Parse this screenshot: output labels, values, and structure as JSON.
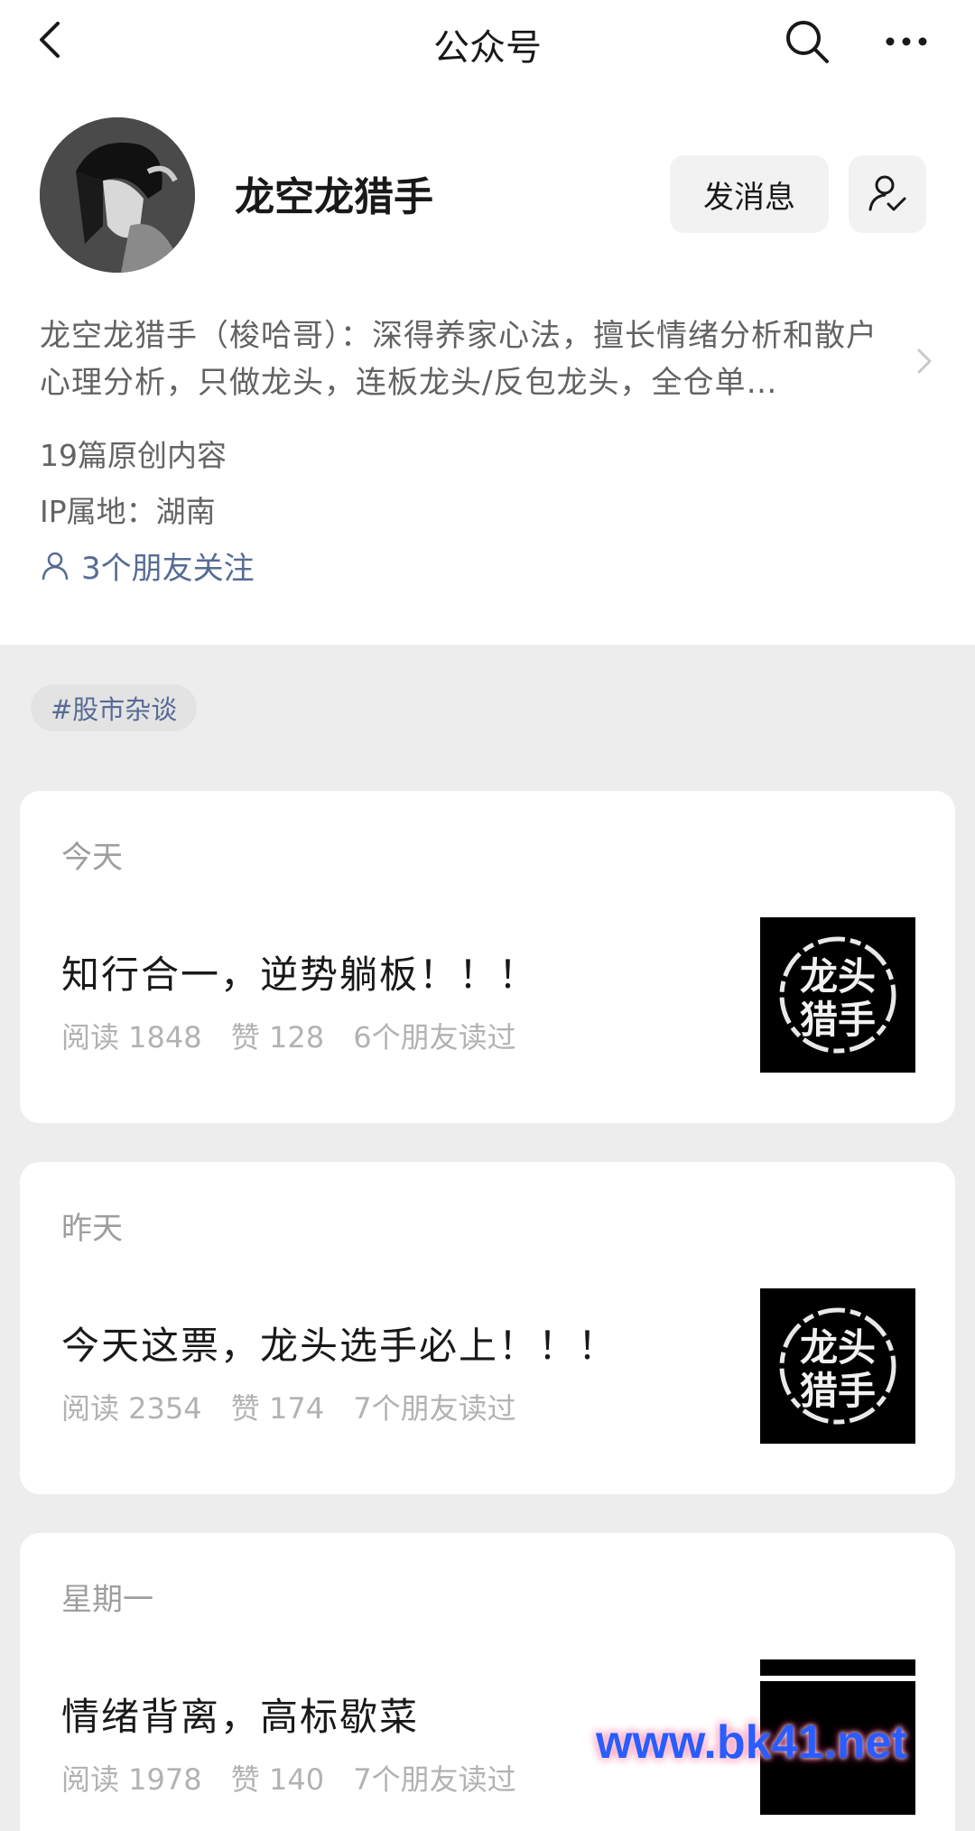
{
  "nav": {
    "title": "公众号",
    "back_icon": "back-arrow-icon",
    "search_icon": "search-icon",
    "more_icon": "more-icon"
  },
  "profile": {
    "name": "龙空龙猎手",
    "message_button": "发消息",
    "intro": "龙空龙猎手（梭哈哥）：深得养家心法，擅长情绪分析和散户心理分析，只做龙头，连板龙头/反包龙头，全仓单…",
    "original_count": "19篇原创内容",
    "ip_location": "IP属地：湖南",
    "friends_following": "3个朋友关注"
  },
  "tag": "#股市杂谈",
  "articles": [
    {
      "date": "今天",
      "title": "知行合一，逆势躺板！！！",
      "reads": "阅读 1848",
      "likes": "赞 128",
      "friends_read": "6个朋友读过",
      "thumb_text_1": "龙头",
      "thumb_text_2": "猎手"
    },
    {
      "date": "昨天",
      "title": "今天这票，龙头选手必上！！！",
      "reads": "阅读 2354",
      "likes": "赞 174",
      "friends_read": "7个朋友读过",
      "thumb_text_1": "龙头",
      "thumb_text_2": "猎手"
    },
    {
      "date": "星期一",
      "title": "情绪背离，高标歇菜",
      "reads": "阅读 1978",
      "likes": "赞 140",
      "friends_read": "7个朋友读过",
      "thumb_text_1": "",
      "thumb_text_2": ""
    }
  ],
  "watermark": "www.bk41.net",
  "colors": {
    "link": "#576b95",
    "background": "#ededed",
    "card": "#ffffff"
  }
}
